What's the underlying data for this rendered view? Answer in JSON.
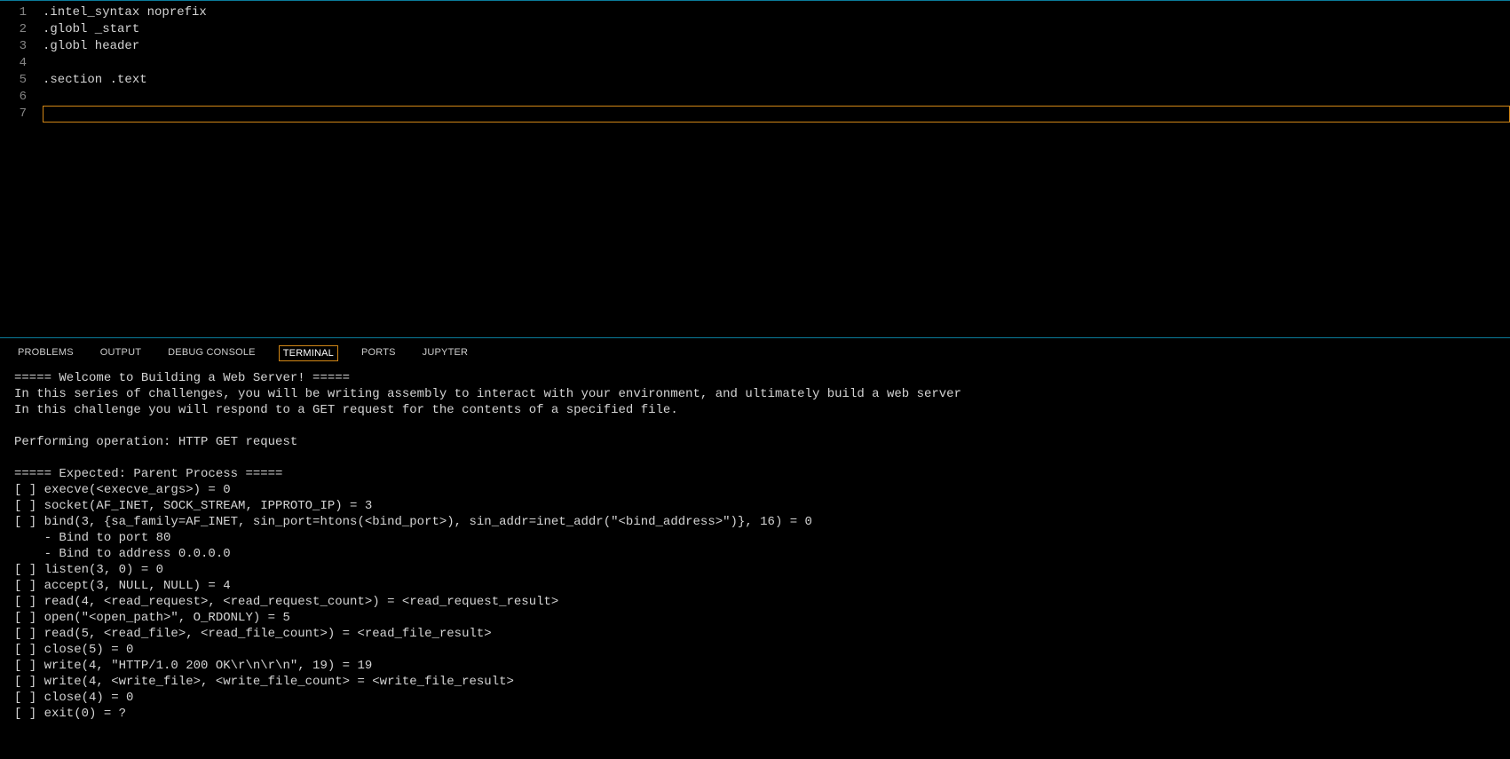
{
  "editor": {
    "lines": [
      ".intel_syntax noprefix",
      ".globl _start",
      ".globl header",
      "",
      ".section .text",
      "",
      ""
    ],
    "lineNumbers": [
      "1",
      "2",
      "3",
      "4",
      "5",
      "6",
      "7"
    ],
    "cursorLine": 7
  },
  "panel": {
    "tabs": [
      {
        "label": "PROBLEMS",
        "active": false
      },
      {
        "label": "OUTPUT",
        "active": false
      },
      {
        "label": "DEBUG CONSOLE",
        "active": false
      },
      {
        "label": "TERMINAL",
        "active": true
      },
      {
        "label": "PORTS",
        "active": false
      },
      {
        "label": "JUPYTER",
        "active": false
      }
    ]
  },
  "terminal": {
    "lines": [
      "===== Welcome to Building a Web Server! =====",
      "In this series of challenges, you will be writing assembly to interact with your environment, and ultimately build a web server",
      "In this challenge you will respond to a GET request for the contents of a specified file.",
      "",
      "Performing operation: HTTP GET request",
      "",
      "===== Expected: Parent Process =====",
      "[ ] execve(<execve_args>) = 0",
      "[ ] socket(AF_INET, SOCK_STREAM, IPPROTO_IP) = 3",
      "[ ] bind(3, {sa_family=AF_INET, sin_port=htons(<bind_port>), sin_addr=inet_addr(\"<bind_address>\")}, 16) = 0",
      "    - Bind to port 80",
      "    - Bind to address 0.0.0.0",
      "[ ] listen(3, 0) = 0",
      "[ ] accept(3, NULL, NULL) = 4",
      "[ ] read(4, <read_request>, <read_request_count>) = <read_request_result>",
      "[ ] open(\"<open_path>\", O_RDONLY) = 5",
      "[ ] read(5, <read_file>, <read_file_count>) = <read_file_result>",
      "[ ] close(5) = 0",
      "[ ] write(4, \"HTTP/1.0 200 OK\\r\\n\\r\\n\", 19) = 19",
      "[ ] write(4, <write_file>, <write_file_count> = <write_file_result>",
      "[ ] close(4) = 0",
      "[ ] exit(0) = ?"
    ]
  }
}
